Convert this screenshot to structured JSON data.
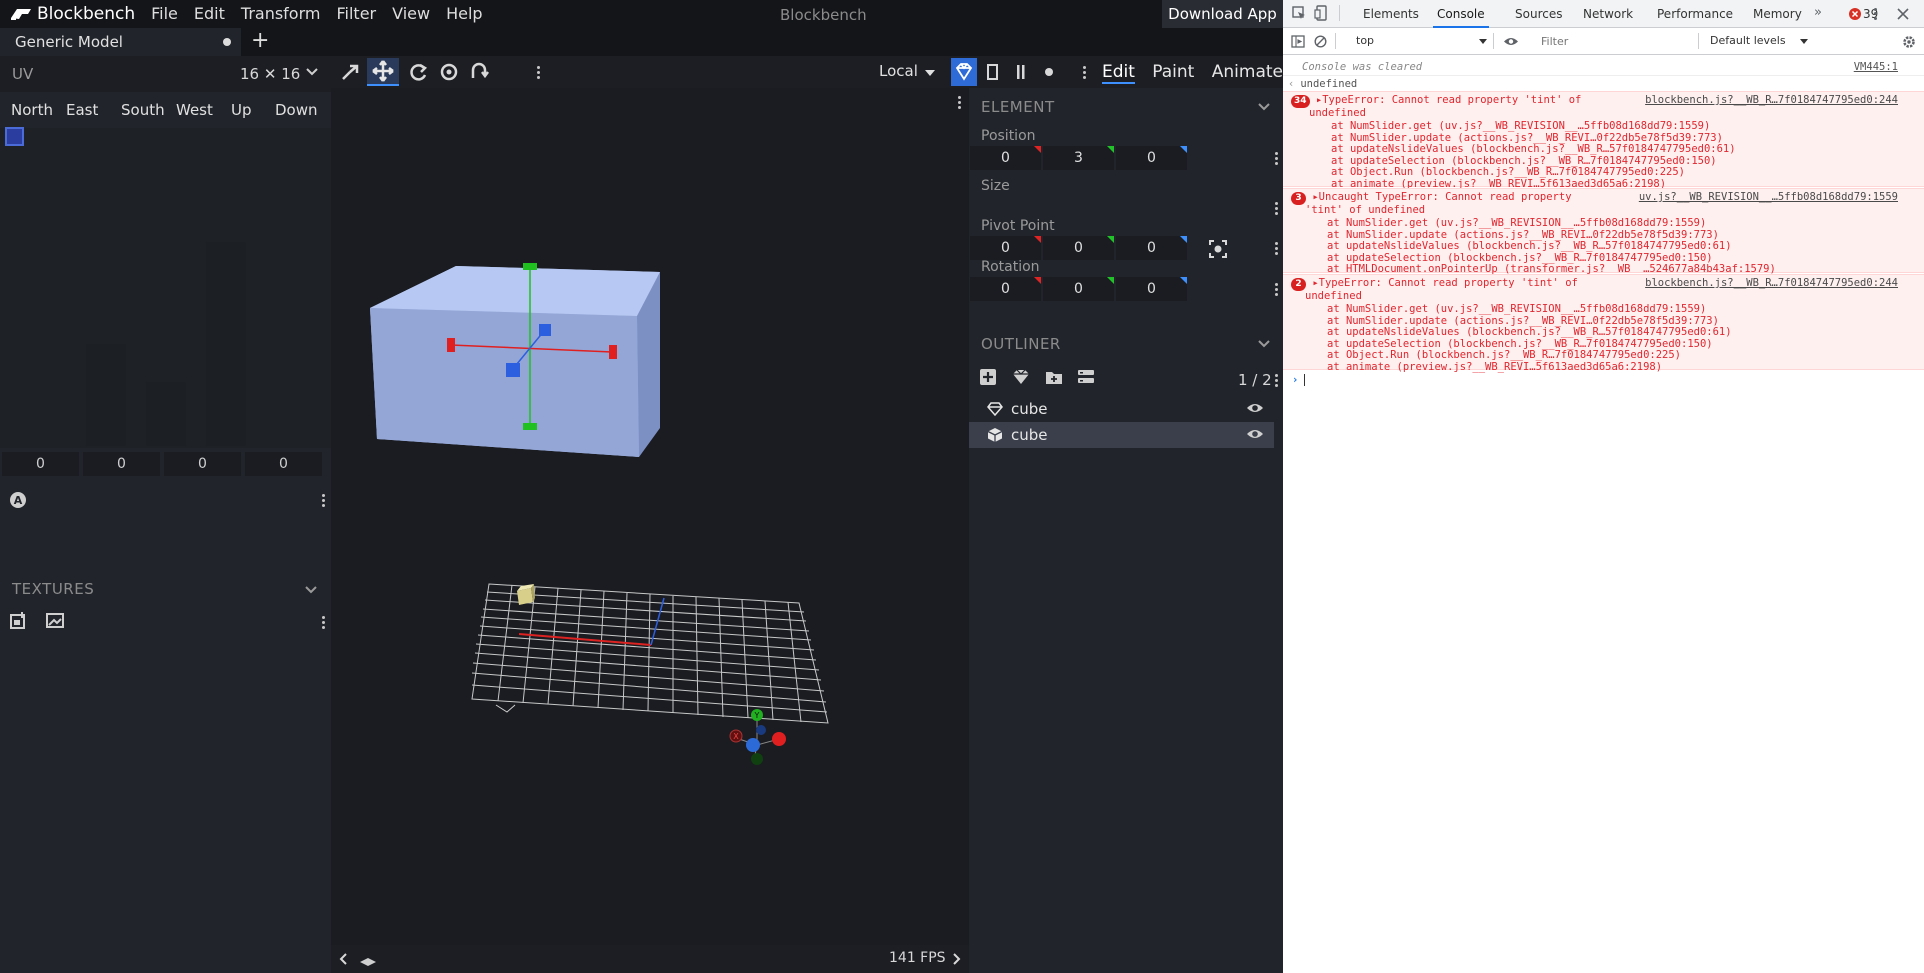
{
  "app": {
    "name": "Blockbench",
    "window_title": "Blockbench",
    "download": "Download App"
  },
  "menu": [
    "File",
    "Edit",
    "Transform",
    "Filter",
    "View",
    "Help"
  ],
  "tab": {
    "name": "Generic Model"
  },
  "uv": {
    "title": "UV",
    "size": "16 ✕ 16",
    "faces": [
      "North",
      "East",
      "South",
      "West",
      "Up",
      "Down"
    ],
    "values": [
      "0",
      "0",
      "0",
      "0"
    ]
  },
  "textures": {
    "title": "TEXTURES"
  },
  "toolbar": {
    "space": "Local"
  },
  "modes": [
    "Edit",
    "Paint",
    "Animate"
  ],
  "viewport": {
    "fps": "141 FPS"
  },
  "element": {
    "title": "ELEMENT",
    "position_label": "Position",
    "position": [
      "0",
      "3",
      "0"
    ],
    "size_label": "Size",
    "pivot_label": "Pivot Point",
    "pivot": [
      "0",
      "0",
      "0"
    ],
    "rotation_label": "Rotation",
    "rotation": [
      "0",
      "0",
      "0"
    ]
  },
  "outliner": {
    "title": "OUTLINER",
    "count": "1 / 2",
    "items": [
      {
        "name": "cube"
      },
      {
        "name": "cube"
      }
    ]
  },
  "devtools": {
    "tabs": [
      "Elements",
      "Console",
      "Sources",
      "Network",
      "Performance",
      "Memory"
    ],
    "error_count": "39",
    "context": "top",
    "filter_placeholder": "Filter",
    "levels": "Default levels",
    "cleared": "Console was cleared",
    "cleared_src": "VM445:1",
    "undefined": "undefined",
    "errors": [
      {
        "count": "34",
        "message": "TypeError: Cannot read property 'tint' of",
        "message2": "undefined",
        "source": "blockbench.js?__WB_R…7f0184747795ed0:244",
        "stack": [
          "at NumSlider.get (uv.js?__WB_REVISION__…5ffb08d168dd79:1559)",
          "at NumSlider.update (actions.js?__WB_REVI…0f22db5e78f5d39:773)",
          "at updateNslideValues (blockbench.js?__WB_R…57f0184747795ed0:61)",
          "at updateSelection (blockbench.js?__WB_R…7f0184747795ed0:150)",
          "at Object.Run (blockbench.js?__WB_R…7f0184747795ed0:225)",
          "at animate (preview.js?__WB_REVI…5f613aed3d65a6:2198)"
        ]
      },
      {
        "count": "3",
        "message": "Uncaught TypeError: Cannot read property",
        "message2": "'tint' of undefined",
        "source": "uv.js?__WB_REVISION__…5ffb08d168dd79:1559",
        "stack": [
          "at NumSlider.get (uv.js?__WB_REVISION__…5ffb08d168dd79:1559)",
          "at NumSlider.update (actions.js?__WB_REVI…0f22db5e78f5d39:773)",
          "at updateNslideValues (blockbench.js?__WB_R…57f0184747795ed0:61)",
          "at updateSelection (blockbench.js?__WB_R…7f0184747795ed0:150)",
          "at HTMLDocument.onPointerUp (transformer.js?__WB__…524677a84b43af:1579)"
        ]
      },
      {
        "count": "2",
        "message": "TypeError: Cannot read property 'tint' of",
        "message2": "undefined",
        "source": "blockbench.js?__WB_R…7f0184747795ed0:244",
        "stack": [
          "at NumSlider.get (uv.js?__WB_REVISION__…5ffb08d168dd79:1559)",
          "at NumSlider.update (actions.js?__WB_REVI…0f22db5e78f5d39:773)",
          "at updateNslideValues (blockbench.js?__WB_R…57f0184747795ed0:61)",
          "at updateSelection (blockbench.js?__WB_R…7f0184747795ed0:150)",
          "at Object.Run (blockbench.js?__WB_R…7f0184747795ed0:225)",
          "at animate (preview.js?__WB_REVI…5f613aed3d65a6:2198)"
        ]
      }
    ]
  }
}
